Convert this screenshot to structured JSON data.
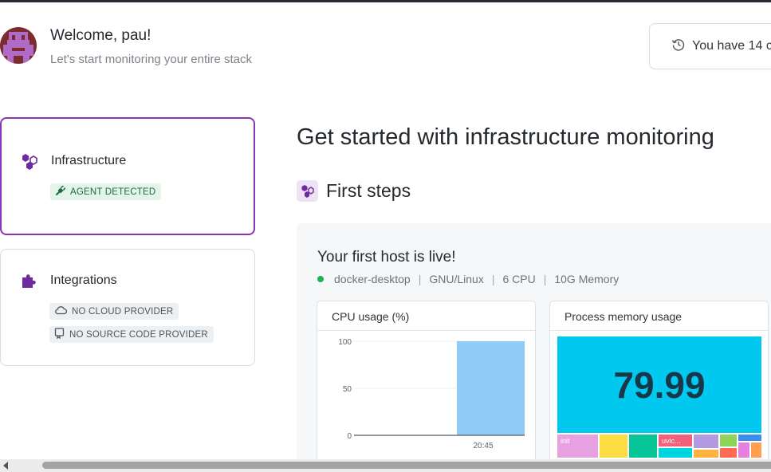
{
  "header": {
    "welcome": "Welcome, pau!",
    "subtitle": "Let's start monitoring your entire stack",
    "trial_text": "You have 14 c"
  },
  "cards": {
    "infrastructure": {
      "title": "Infrastructure",
      "badge": "AGENT DETECTED",
      "icon": "hexagons-icon"
    },
    "integrations": {
      "title": "Integrations",
      "badges": [
        "NO CLOUD PROVIDER",
        "NO SOURCE CODE PROVIDER"
      ],
      "icon": "puzzle-icon"
    }
  },
  "main": {
    "title": "Get started with infrastructure monitoring",
    "section": "First steps",
    "host": {
      "title": "Your first host is live!",
      "name": "docker-desktop",
      "os": "GNU/Linux",
      "cpu": "6 CPU",
      "memory": "10G Memory",
      "status_color": "#1bb35a"
    },
    "widgets": {
      "cpu_title": "CPU usage (%)",
      "memory_title": "Process memory usage"
    }
  },
  "chart_data": [
    {
      "type": "bar",
      "title": "CPU usage (%)",
      "categories": [
        "20:45"
      ],
      "values": [
        100
      ],
      "yticks": [
        "100",
        "50",
        "0"
      ],
      "ylim": [
        0,
        100
      ],
      "grid": true,
      "color": "#8ecbf7"
    },
    {
      "type": "heatmap",
      "title": "Process memory usage",
      "main_value": "79.99",
      "cells": [
        {
          "label": "",
          "color": "#00c8ef"
        },
        {
          "label": "init",
          "color": "#e8a1e0"
        },
        {
          "label": "",
          "color": "#fbdc42"
        },
        {
          "label": "",
          "color": "#06c596"
        },
        {
          "label": "uvic...",
          "color": "#f4607a"
        },
        {
          "label": "",
          "color": "#00d6e0"
        },
        {
          "label": "",
          "color": "#b39ae0"
        },
        {
          "label": "",
          "color": "#ffb240"
        },
        {
          "label": "",
          "color": "#8fd45a"
        },
        {
          "label": "",
          "color": "#ff6a50"
        },
        {
          "label": "",
          "color": "#3a8ef0"
        },
        {
          "label": "",
          "color": "#e680e0"
        },
        {
          "label": "",
          "color": "#ffa050"
        }
      ]
    }
  ]
}
